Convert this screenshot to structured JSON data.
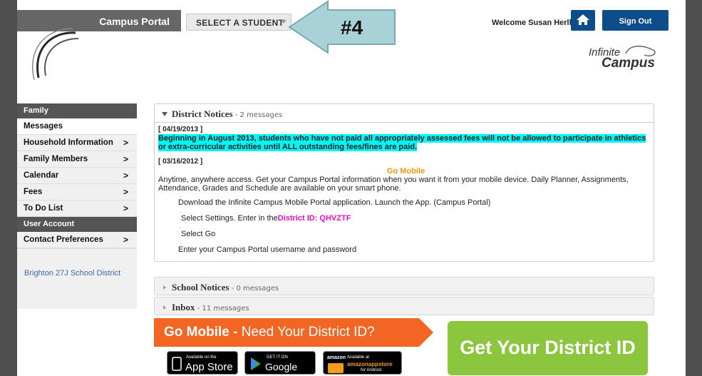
{
  "header": {
    "app_title": "Campus Portal",
    "select_student": "SELECT A STUDENT",
    "annotation": "#4",
    "welcome": "Welcome Susan Herll",
    "sign_out": "Sign Out",
    "logo_line1": "Infinite",
    "logo_line2": "Campus"
  },
  "sidebar": {
    "family_header": "Family",
    "items": [
      {
        "label": "Messages",
        "chevron": ""
      },
      {
        "label": "Household Information",
        "chevron": ">"
      },
      {
        "label": "Family Members",
        "chevron": ">"
      },
      {
        "label": "Calendar",
        "chevron": ">"
      },
      {
        "label": "Fees",
        "chevron": ">"
      },
      {
        "label": "To Do List",
        "chevron": ">"
      }
    ],
    "account_header": "User Account",
    "account_items": [
      {
        "label": "Contact Preferences",
        "chevron": ">"
      }
    ],
    "district": "Brighton 27J School District"
  },
  "district_notices": {
    "title": "District Notices",
    "count": " - 2 messages",
    "notice1_date": "[ 04/19/2013 ]",
    "notice1_text": "Beginning in August 2013, students who have not paid all appropriately assessed fees will not be allowed to participate in athletics or extra-curricular activities until ALL outstanding fees/fines are paid.",
    "notice2_date": "[ 03/16/2012 ]",
    "go_mobile": "Go Mobile",
    "intro": "Anytime, anywhere access. Get your Campus Portal information when you want it from your mobile device. Daily Planner, Assignments, Attendance, Grades and Schedule are available on your smart phone.",
    "dot": ".",
    "step1": "Download the Infinite Campus Mobile Portal application.  Launch the App. (Campus Portal)",
    "step2_prefix": "Select Settings. Enter in the",
    "step2_id": "District ID: QHVZTF",
    "step3": "Select Go",
    "step4": "Enter your Campus Portal username and password"
  },
  "school_notices": {
    "title": "School Notices",
    "count": " - 0 messages"
  },
  "inbox": {
    "title": "Inbox",
    "count": " - 11 messages"
  },
  "banner": {
    "go_mobile": "Go Mobile -",
    "need_id": " Need Your District ID?",
    "get_id": "Get Your District ID",
    "app_store_small": "Available on the",
    "app_store": "App Store",
    "google_small": "GET IT ON",
    "google": "Google play",
    "amazon_small": "Available at",
    "amazon": "amazonappstore",
    "amazon_sub": "for Android",
    "amazon_logo": "amazon"
  },
  "colors": {
    "header_blue": "#0d4d8c",
    "highlight": "#00f5f5",
    "go_mobile_orange": "#e89b0a",
    "district_pink": "#e60ec7",
    "green_button": "#8cc63e",
    "banner_orange": "#f26522"
  }
}
